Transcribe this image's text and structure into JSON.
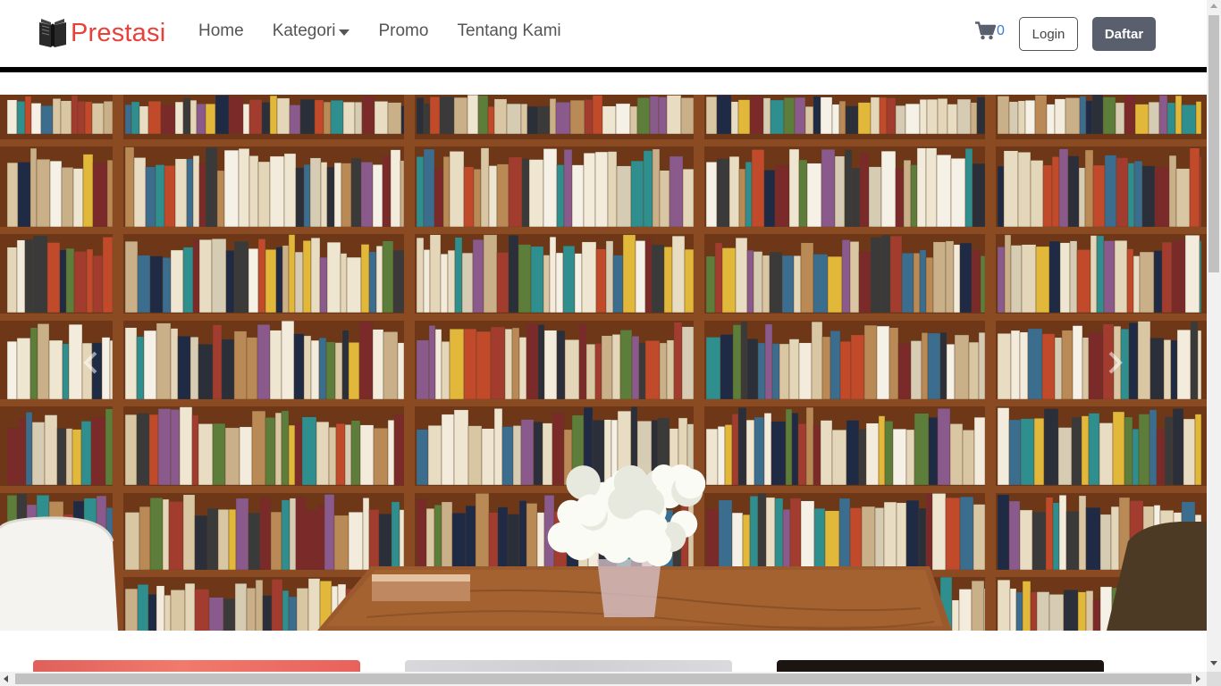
{
  "brand": {
    "name": "Prestasi",
    "icon": "book-logo-icon",
    "color": "#e8403a"
  },
  "nav": {
    "items": [
      {
        "label": "Home",
        "has_dropdown": false
      },
      {
        "label": "Kategori",
        "has_dropdown": true
      },
      {
        "label": "Promo",
        "has_dropdown": false
      },
      {
        "label": "Tentang Kami",
        "has_dropdown": false
      }
    ]
  },
  "cart": {
    "icon": "shopping-cart-icon",
    "count": "0"
  },
  "auth": {
    "login_label": "Login",
    "register_label": "Daftar"
  },
  "carousel": {
    "image": "bookshelf-library-photo",
    "prev_icon": "chevron-left-icon",
    "next_icon": "chevron-right-icon"
  },
  "cards": [
    {
      "image": "red-card-image"
    },
    {
      "image": "grey-card-image"
    },
    {
      "image": "dark-card-image"
    }
  ]
}
